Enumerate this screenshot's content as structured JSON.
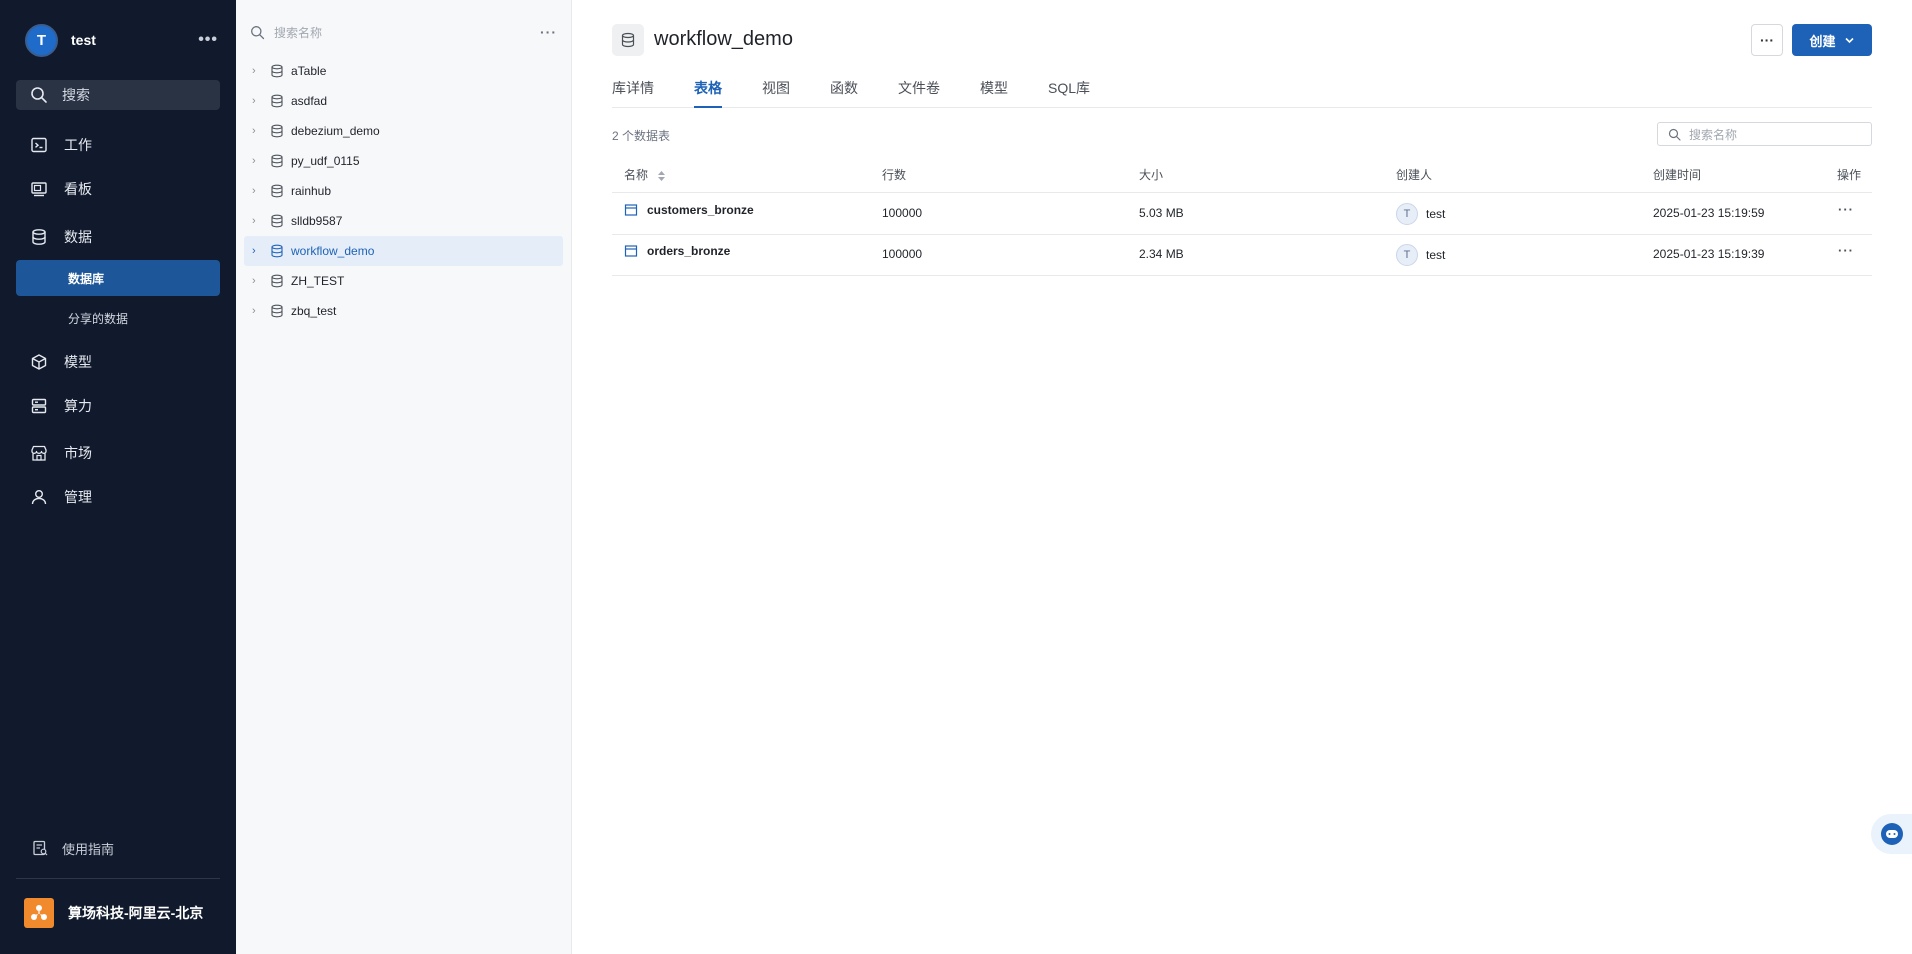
{
  "user": {
    "initial": "T",
    "name": "test",
    "more": "•••"
  },
  "nav": {
    "search_label": "搜索",
    "items": [
      {
        "label": "工作",
        "icon": "terminal-icon"
      },
      {
        "label": "看板",
        "icon": "monitor-icon"
      },
      {
        "label": "数据",
        "icon": "database-icon"
      },
      {
        "label": "模型",
        "icon": "cube-icon"
      },
      {
        "label": "算力",
        "icon": "server-icon"
      },
      {
        "label": "市场",
        "icon": "store-icon"
      },
      {
        "label": "管理",
        "icon": "person-icon"
      }
    ],
    "sub_items": [
      {
        "label": "数据库",
        "active": true
      },
      {
        "label": "分享的数据",
        "active": false
      }
    ],
    "guide_label": "使用指南",
    "org_name": "算场科技-阿里云-北京"
  },
  "tree": {
    "search_placeholder": "搜索名称",
    "more": "···",
    "items": [
      {
        "name": "aTable"
      },
      {
        "name": "asdfad"
      },
      {
        "name": "debezium_demo"
      },
      {
        "name": "py_udf_0115"
      },
      {
        "name": "rainhub"
      },
      {
        "name": "slldb9587"
      },
      {
        "name": "workflow_demo",
        "active": true
      },
      {
        "name": "ZH_TEST"
      },
      {
        "name": "zbq_test"
      }
    ]
  },
  "main": {
    "title": "workflow_demo",
    "more_button": "···",
    "create_button": "创建",
    "tabs": [
      {
        "label": "库详情"
      },
      {
        "label": "表格",
        "active": true
      },
      {
        "label": "视图"
      },
      {
        "label": "函数"
      },
      {
        "label": "文件卷"
      },
      {
        "label": "模型"
      },
      {
        "label": "SQL库"
      }
    ],
    "count_text": "2 个数据表",
    "search_placeholder": "搜索名称",
    "columns": [
      "名称",
      "行数",
      "大小",
      "创建人",
      "创建时间",
      "操作"
    ],
    "rows": [
      {
        "name": "customers_bronze",
        "rows": "100000",
        "size": "5.03 MB",
        "owner_initial": "T",
        "owner": "test",
        "created": "2025-01-23 15:19:59",
        "action": "···"
      },
      {
        "name": "orders_bronze",
        "rows": "100000",
        "size": "2.34 MB",
        "owner_initial": "T",
        "owner": "test",
        "created": "2025-01-23 15:19:39",
        "action": "···"
      }
    ]
  },
  "colors": {
    "nav_bg": "#111a2c",
    "accent": "#1e62b8",
    "active_nav": "#1e5799",
    "tree_bg": "#f7f8fa",
    "org_logo": "#f08a2c"
  }
}
